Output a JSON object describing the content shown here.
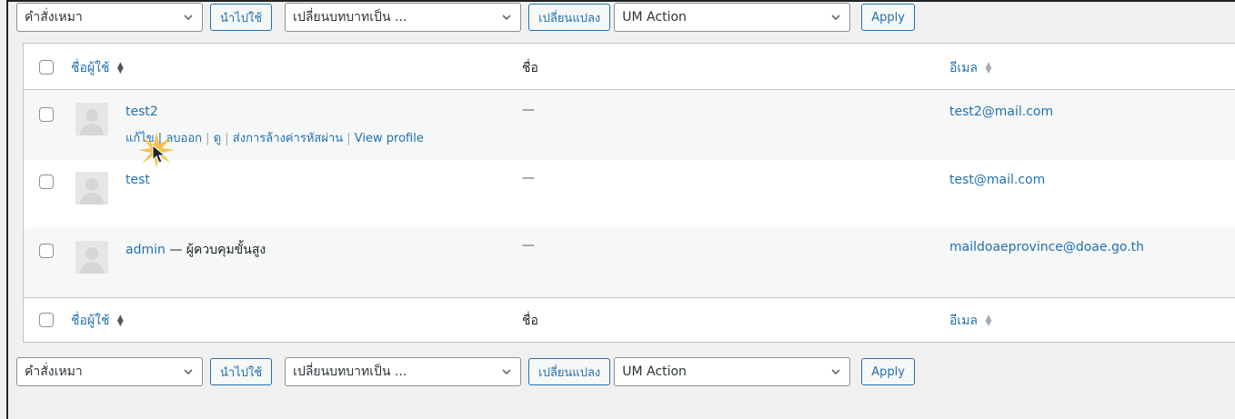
{
  "toolbar": {
    "bulk_action": "คำสั่งเหมา",
    "apply_bulk": "นำไปใช้",
    "change_role": "เปลี่ยนบทบาทเป็น ...",
    "change_button": "เปลี่ยนแปลง",
    "um_action": "UM Action",
    "apply": "Apply"
  },
  "columns": {
    "username": "ชื่อผู้ใช้",
    "name": "ชื่อ",
    "email": "อีเมล"
  },
  "users": [
    {
      "username": "test2",
      "role_note": "",
      "name": "—",
      "email": "test2@mail.com",
      "row_actions": {
        "edit_delete": "แก้ไข | ลบออก",
        "view": "ดู",
        "reset": "ส่งการล้างค่ารหัสผ่าน",
        "profile": "View profile"
      }
    },
    {
      "username": "test",
      "role_note": "",
      "name": "—",
      "email": "test@mail.com"
    },
    {
      "username": "admin",
      "role_note": " — ผู้ควบคุมขั้นสูง",
      "name": "—",
      "email": "maildoaeprovince@doae.go.th"
    }
  ],
  "colors": {
    "link": "#2271b1",
    "border": "#c3c4c7",
    "background": "#f0f0f1"
  }
}
